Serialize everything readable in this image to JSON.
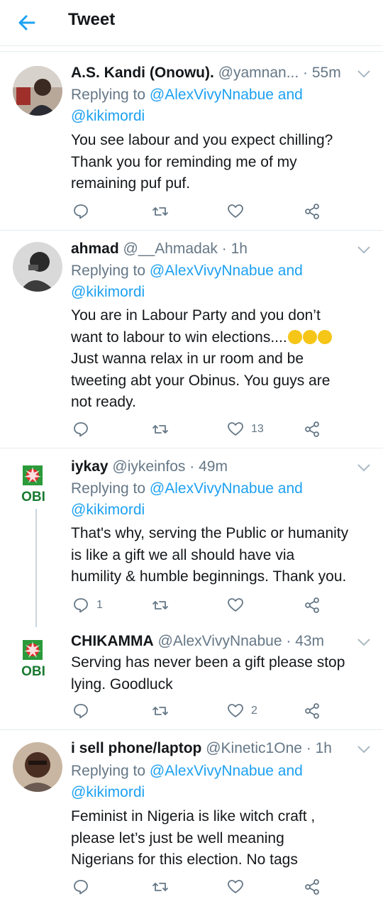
{
  "header": {
    "title": "Tweet"
  },
  "tweets": [
    {
      "name": "A.S. Kandi (Onowu).",
      "handle": "@yamnan...",
      "time": " · 55m",
      "replying_prefix": "Replying to ",
      "replying_to_1": "@AlexVivyNnabue and",
      "replying_to_2": "@kikimordi",
      "lines": [
        "You see labour and you expect chilling?",
        "Thank you for reminding me of my",
        "remaining puf puf."
      ],
      "likes": "",
      "replies": ""
    },
    {
      "name": "ahmad",
      "handle": "@__Ahmadak",
      "time": " · 1h",
      "replying_prefix": "Replying to ",
      "replying_to_1": "@AlexVivyNnabue and",
      "replying_to_2": "@kikimordi",
      "lines": [
        "You are in Labour Party and you don’t",
        "want to labour to win elections....",
        "Just wanna relax in ur room and be",
        "tweeting abt your Obinus. You guys are",
        "not ready."
      ],
      "likes": "13",
      "replies": ""
    },
    {
      "name": "iykay",
      "handle": "@iykeinfos",
      "time": " · 49m",
      "replying_prefix": "Replying to ",
      "replying_to_1": "@AlexVivyNnabue and",
      "replying_to_2": "@kikimordi",
      "lines": [
        "That's why, serving the Public or humanity",
        "is like a gift we all should have via",
        "humility & humble beginnings. Thank you."
      ],
      "likes": "",
      "replies": "1",
      "logo_text": "OBI"
    },
    {
      "name": "CHIKAMMA",
      "handle": "@AlexVivyNnabue",
      "time": " · 43m",
      "lines": [
        "Serving has never been a gift please stop",
        "lying. Goodluck"
      ],
      "likes": "2",
      "replies": "",
      "logo_text": "OBI"
    },
    {
      "name": "i sell phone/laptop",
      "handle": "@Kinetic1One",
      "time": " · 1h",
      "replying_prefix": "Replying to ",
      "replying_to_1": "@AlexVivyNnabue and",
      "replying_to_2": "@kikimordi",
      "lines": [
        "Feminist in Nigeria is like witch craft ,",
        "please let’s just be well meaning",
        "Nigerians for this election. No tags"
      ],
      "likes": "",
      "replies": ""
    }
  ]
}
